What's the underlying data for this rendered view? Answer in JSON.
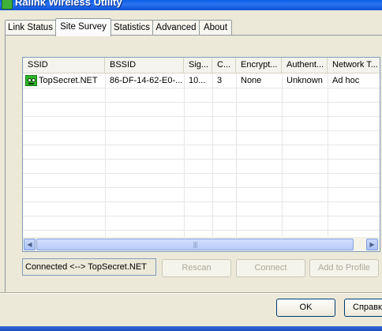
{
  "window": {
    "title": "Ralink Wireless Utility"
  },
  "tabs": [
    {
      "label": "Link Status"
    },
    {
      "label": "Site Survey",
      "active": true
    },
    {
      "label": "Statistics"
    },
    {
      "label": "Advanced"
    },
    {
      "label": "About"
    }
  ],
  "list": {
    "columns": [
      "SSID",
      "BSSID",
      "Sig...",
      "C...",
      "Encrypt...",
      "Authent...",
      "Network T..."
    ],
    "rows": [
      {
        "icon": "adhoc-network-icon",
        "ssid": "TopSecret.NET",
        "bssid": "86-DF-14-62-E0-...",
        "signal": "10...",
        "channel": "3",
        "encryption": "None",
        "authentication": "Unknown",
        "network_type": "Ad hoc"
      }
    ]
  },
  "scrollbar": {
    "left_arrow": "◀",
    "right_arrow": "▶",
    "grip": "|||"
  },
  "status": {
    "text": "Connected <--> TopSecret.NET"
  },
  "actions": {
    "rescan": "Rescan",
    "connect": "Connect",
    "add_to_profile": "Add to Profile"
  },
  "dialog": {
    "ok": "OK",
    "help": "Справк"
  },
  "colors": {
    "title_bar": "#0a5fe6",
    "dialog_bg": "#ece9d8",
    "adhoc_icon": "#2fb52a"
  }
}
